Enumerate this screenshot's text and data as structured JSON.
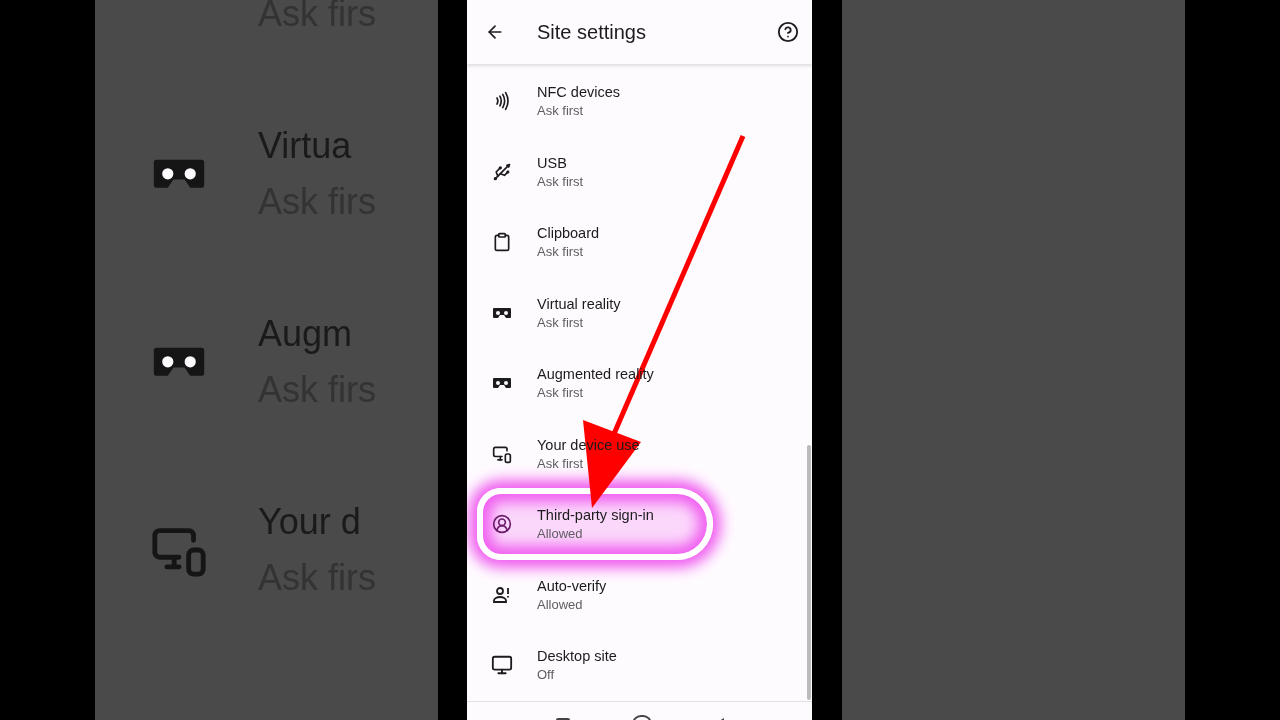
{
  "backdrop": {
    "rows": [
      {
        "subtitle": "Ask firs"
      },
      {
        "kind": "vr",
        "title": "Virtua",
        "subtitle": "Ask firs"
      },
      {
        "kind": "vr",
        "title": "Augm",
        "subtitle": "Ask firs"
      },
      {
        "kind": "device",
        "title": "Your d",
        "subtitle": "Ask firs"
      }
    ]
  },
  "header": {
    "title": "Site settings"
  },
  "items": [
    {
      "kind": "nfc",
      "title": "NFC devices",
      "subtitle": "Ask first",
      "highlighted": false
    },
    {
      "kind": "usb",
      "title": "USB",
      "subtitle": "Ask first",
      "highlighted": false
    },
    {
      "kind": "clipboard",
      "title": "Clipboard",
      "subtitle": "Ask first",
      "highlighted": false
    },
    {
      "kind": "vr",
      "title": "Virtual reality",
      "subtitle": "Ask first",
      "highlighted": false
    },
    {
      "kind": "vr",
      "title": "Augmented reality",
      "subtitle": "Ask first",
      "highlighted": false
    },
    {
      "kind": "device",
      "title": "Your device use",
      "subtitle": "Ask first",
      "highlighted": false
    },
    {
      "kind": "signin",
      "title": "Third-party sign-in",
      "subtitle": "Allowed",
      "highlighted": true
    },
    {
      "kind": "verify",
      "title": "Auto-verify",
      "subtitle": "Allowed",
      "highlighted": false
    },
    {
      "kind": "desktop",
      "title": "Desktop site",
      "subtitle": "Off",
      "highlighted": false
    }
  ]
}
